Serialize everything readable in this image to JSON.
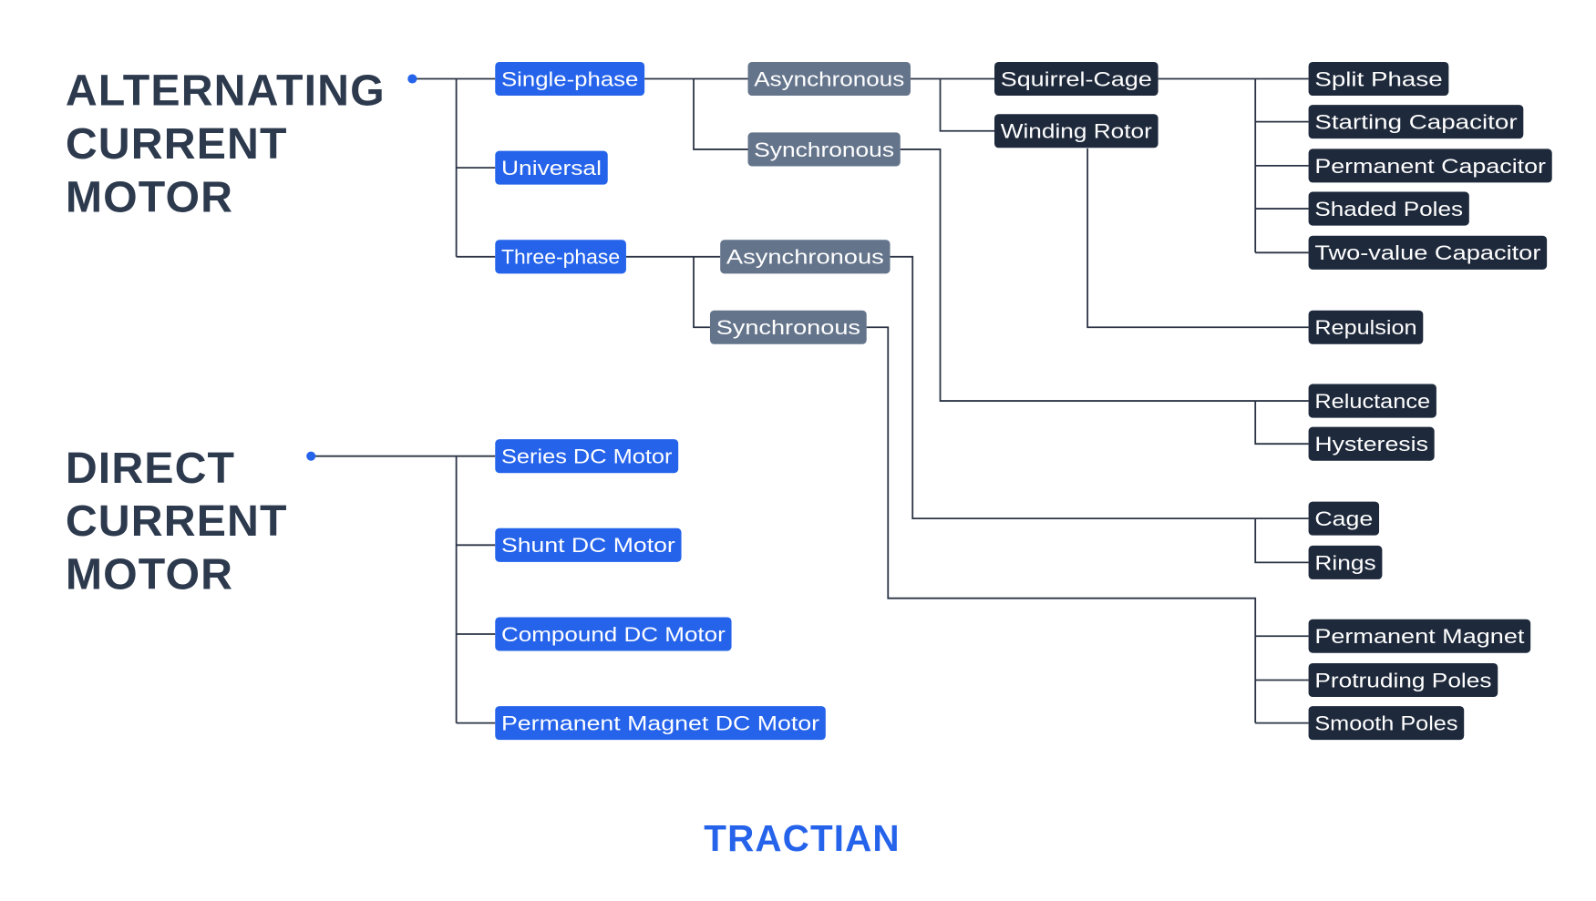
{
  "colors": {
    "primary": "#2563eb",
    "secondary": "#64748b",
    "tertiary": "#1e293b",
    "title": "#2d3a4e",
    "line": "#2b3445"
  },
  "groups": [
    {
      "id": "ac",
      "title_lines": [
        "ALTERNATING",
        "CURRENT",
        "MOTOR"
      ]
    },
    {
      "id": "dc",
      "title_lines": [
        "DIRECT",
        "CURRENT",
        "MOTOR"
      ]
    }
  ],
  "nodes": {
    "single_phase": {
      "label": "Single-phase",
      "level": "primary"
    },
    "universal": {
      "label": "Universal",
      "level": "primary"
    },
    "three_phase": {
      "label": "Three-phase",
      "level": "primary"
    },
    "series_dc": {
      "label": "Series DC Motor",
      "level": "primary"
    },
    "shunt_dc": {
      "label": "Shunt DC Motor",
      "level": "primary"
    },
    "compound_dc": {
      "label": "Compound DC Motor",
      "level": "primary"
    },
    "pm_dc": {
      "label": "Permanent Magnet DC Motor",
      "level": "primary"
    },
    "sp_async": {
      "label": "Asynchronous",
      "level": "secondary"
    },
    "sp_sync": {
      "label": "Synchronous",
      "level": "secondary"
    },
    "tp_async": {
      "label": "Asynchronous",
      "level": "secondary"
    },
    "tp_sync": {
      "label": "Synchronous",
      "level": "secondary"
    },
    "squirrel_cage": {
      "label": "Squirrel-Cage",
      "level": "tertiary"
    },
    "winding_rotor": {
      "label": "Winding Rotor",
      "level": "tertiary"
    },
    "split_phase": {
      "label": "Split Phase",
      "level": "tertiary"
    },
    "starting_cap": {
      "label": "Starting Capacitor",
      "level": "tertiary"
    },
    "permanent_cap": {
      "label": "Permanent Capacitor",
      "level": "tertiary"
    },
    "shaded_poles": {
      "label": "Shaded Poles",
      "level": "tertiary"
    },
    "two_value_cap": {
      "label": "Two-value Capacitor",
      "level": "tertiary"
    },
    "repulsion": {
      "label": "Repulsion",
      "level": "tertiary"
    },
    "reluctance": {
      "label": "Reluctance",
      "level": "tertiary"
    },
    "hysteresis": {
      "label": "Hysteresis",
      "level": "tertiary"
    },
    "cage": {
      "label": "Cage",
      "level": "tertiary"
    },
    "rings": {
      "label": "Rings",
      "level": "tertiary"
    },
    "permanent_magnet": {
      "label": "Permanent Magnet",
      "level": "tertiary"
    },
    "protruding_poles": {
      "label": "Protruding Poles",
      "level": "tertiary"
    },
    "smooth_poles": {
      "label": "Smooth Poles",
      "level": "tertiary"
    }
  },
  "edges": [
    [
      "ac",
      "single_phase"
    ],
    [
      "ac",
      "universal"
    ],
    [
      "ac",
      "three_phase"
    ],
    [
      "dc",
      "series_dc"
    ],
    [
      "dc",
      "shunt_dc"
    ],
    [
      "dc",
      "compound_dc"
    ],
    [
      "dc",
      "pm_dc"
    ],
    [
      "single_phase",
      "sp_async"
    ],
    [
      "single_phase",
      "sp_sync"
    ],
    [
      "three_phase",
      "tp_async"
    ],
    [
      "three_phase",
      "tp_sync"
    ],
    [
      "sp_async",
      "squirrel_cage"
    ],
    [
      "sp_async",
      "winding_rotor"
    ],
    [
      "squirrel_cage",
      "split_phase"
    ],
    [
      "squirrel_cage",
      "starting_cap"
    ],
    [
      "squirrel_cage",
      "permanent_cap"
    ],
    [
      "squirrel_cage",
      "shaded_poles"
    ],
    [
      "squirrel_cage",
      "two_value_cap"
    ],
    [
      "winding_rotor",
      "repulsion"
    ],
    [
      "sp_sync",
      "reluctance"
    ],
    [
      "sp_sync",
      "hysteresis"
    ],
    [
      "tp_async",
      "cage"
    ],
    [
      "tp_async",
      "rings"
    ],
    [
      "tp_sync",
      "permanent_magnet"
    ],
    [
      "tp_sync",
      "protruding_poles"
    ],
    [
      "tp_sync",
      "smooth_poles"
    ]
  ],
  "logo": {
    "text": "TRACTIAN",
    "color": "#2563eb"
  }
}
